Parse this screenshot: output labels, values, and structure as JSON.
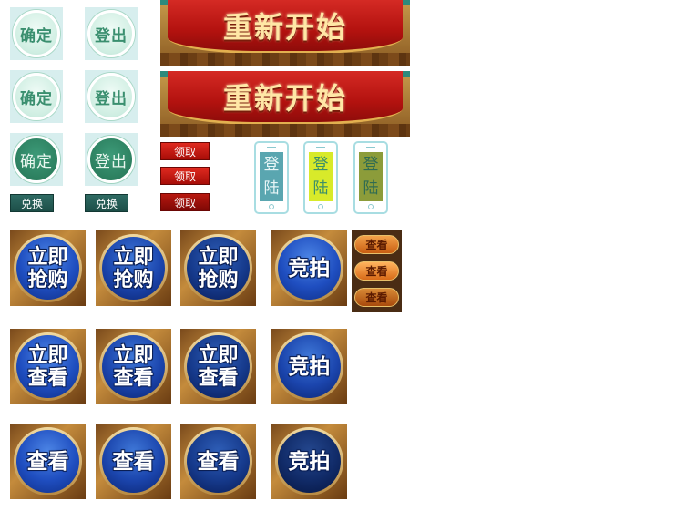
{
  "green_buttons": {
    "confirm": "确定",
    "logout": "登出"
  },
  "teal_buttons": {
    "exchange": "兑换"
  },
  "banner": {
    "restart": "重新开始"
  },
  "red_buttons": {
    "claim": "领取"
  },
  "phone_buttons": {
    "login_chars": [
      "登",
      "陆"
    ],
    "colors": [
      "#5aa6b0",
      "#d8ea2a",
      "#8c9c3a"
    ]
  },
  "blue_buttons": {
    "buy_now": [
      "立即",
      "抢购"
    ],
    "view_now": [
      "立即",
      "查看"
    ],
    "auction": "竞拍",
    "view": "查看"
  },
  "small_view": {
    "label": "查看"
  }
}
